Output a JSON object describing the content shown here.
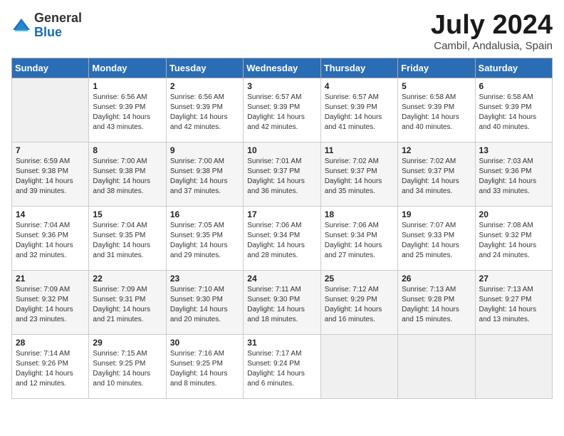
{
  "header": {
    "logo_general": "General",
    "logo_blue": "Blue",
    "month_title": "July 2024",
    "location": "Cambil, Andalusia, Spain"
  },
  "days_of_week": [
    "Sunday",
    "Monday",
    "Tuesday",
    "Wednesday",
    "Thursday",
    "Friday",
    "Saturday"
  ],
  "weeks": [
    [
      {
        "day": "",
        "sunrise": "",
        "sunset": "",
        "daylight": ""
      },
      {
        "day": "1",
        "sunrise": "Sunrise: 6:56 AM",
        "sunset": "Sunset: 9:39 PM",
        "daylight": "Daylight: 14 hours and 43 minutes."
      },
      {
        "day": "2",
        "sunrise": "Sunrise: 6:56 AM",
        "sunset": "Sunset: 9:39 PM",
        "daylight": "Daylight: 14 hours and 42 minutes."
      },
      {
        "day": "3",
        "sunrise": "Sunrise: 6:57 AM",
        "sunset": "Sunset: 9:39 PM",
        "daylight": "Daylight: 14 hours and 42 minutes."
      },
      {
        "day": "4",
        "sunrise": "Sunrise: 6:57 AM",
        "sunset": "Sunset: 9:39 PM",
        "daylight": "Daylight: 14 hours and 41 minutes."
      },
      {
        "day": "5",
        "sunrise": "Sunrise: 6:58 AM",
        "sunset": "Sunset: 9:39 PM",
        "daylight": "Daylight: 14 hours and 40 minutes."
      },
      {
        "day": "6",
        "sunrise": "Sunrise: 6:58 AM",
        "sunset": "Sunset: 9:39 PM",
        "daylight": "Daylight: 14 hours and 40 minutes."
      }
    ],
    [
      {
        "day": "7",
        "sunrise": "Sunrise: 6:59 AM",
        "sunset": "Sunset: 9:38 PM",
        "daylight": "Daylight: 14 hours and 39 minutes."
      },
      {
        "day": "8",
        "sunrise": "Sunrise: 7:00 AM",
        "sunset": "Sunset: 9:38 PM",
        "daylight": "Daylight: 14 hours and 38 minutes."
      },
      {
        "day": "9",
        "sunrise": "Sunrise: 7:00 AM",
        "sunset": "Sunset: 9:38 PM",
        "daylight": "Daylight: 14 hours and 37 minutes."
      },
      {
        "day": "10",
        "sunrise": "Sunrise: 7:01 AM",
        "sunset": "Sunset: 9:37 PM",
        "daylight": "Daylight: 14 hours and 36 minutes."
      },
      {
        "day": "11",
        "sunrise": "Sunrise: 7:02 AM",
        "sunset": "Sunset: 9:37 PM",
        "daylight": "Daylight: 14 hours and 35 minutes."
      },
      {
        "day": "12",
        "sunrise": "Sunrise: 7:02 AM",
        "sunset": "Sunset: 9:37 PM",
        "daylight": "Daylight: 14 hours and 34 minutes."
      },
      {
        "day": "13",
        "sunrise": "Sunrise: 7:03 AM",
        "sunset": "Sunset: 9:36 PM",
        "daylight": "Daylight: 14 hours and 33 minutes."
      }
    ],
    [
      {
        "day": "14",
        "sunrise": "Sunrise: 7:04 AM",
        "sunset": "Sunset: 9:36 PM",
        "daylight": "Daylight: 14 hours and 32 minutes."
      },
      {
        "day": "15",
        "sunrise": "Sunrise: 7:04 AM",
        "sunset": "Sunset: 9:35 PM",
        "daylight": "Daylight: 14 hours and 31 minutes."
      },
      {
        "day": "16",
        "sunrise": "Sunrise: 7:05 AM",
        "sunset": "Sunset: 9:35 PM",
        "daylight": "Daylight: 14 hours and 29 minutes."
      },
      {
        "day": "17",
        "sunrise": "Sunrise: 7:06 AM",
        "sunset": "Sunset: 9:34 PM",
        "daylight": "Daylight: 14 hours and 28 minutes."
      },
      {
        "day": "18",
        "sunrise": "Sunrise: 7:06 AM",
        "sunset": "Sunset: 9:34 PM",
        "daylight": "Daylight: 14 hours and 27 minutes."
      },
      {
        "day": "19",
        "sunrise": "Sunrise: 7:07 AM",
        "sunset": "Sunset: 9:33 PM",
        "daylight": "Daylight: 14 hours and 25 minutes."
      },
      {
        "day": "20",
        "sunrise": "Sunrise: 7:08 AM",
        "sunset": "Sunset: 9:32 PM",
        "daylight": "Daylight: 14 hours and 24 minutes."
      }
    ],
    [
      {
        "day": "21",
        "sunrise": "Sunrise: 7:09 AM",
        "sunset": "Sunset: 9:32 PM",
        "daylight": "Daylight: 14 hours and 23 minutes."
      },
      {
        "day": "22",
        "sunrise": "Sunrise: 7:09 AM",
        "sunset": "Sunset: 9:31 PM",
        "daylight": "Daylight: 14 hours and 21 minutes."
      },
      {
        "day": "23",
        "sunrise": "Sunrise: 7:10 AM",
        "sunset": "Sunset: 9:30 PM",
        "daylight": "Daylight: 14 hours and 20 minutes."
      },
      {
        "day": "24",
        "sunrise": "Sunrise: 7:11 AM",
        "sunset": "Sunset: 9:30 PM",
        "daylight": "Daylight: 14 hours and 18 minutes."
      },
      {
        "day": "25",
        "sunrise": "Sunrise: 7:12 AM",
        "sunset": "Sunset: 9:29 PM",
        "daylight": "Daylight: 14 hours and 16 minutes."
      },
      {
        "day": "26",
        "sunrise": "Sunrise: 7:13 AM",
        "sunset": "Sunset: 9:28 PM",
        "daylight": "Daylight: 14 hours and 15 minutes."
      },
      {
        "day": "27",
        "sunrise": "Sunrise: 7:13 AM",
        "sunset": "Sunset: 9:27 PM",
        "daylight": "Daylight: 14 hours and 13 minutes."
      }
    ],
    [
      {
        "day": "28",
        "sunrise": "Sunrise: 7:14 AM",
        "sunset": "Sunset: 9:26 PM",
        "daylight": "Daylight: 14 hours and 12 minutes."
      },
      {
        "day": "29",
        "sunrise": "Sunrise: 7:15 AM",
        "sunset": "Sunset: 9:25 PM",
        "daylight": "Daylight: 14 hours and 10 minutes."
      },
      {
        "day": "30",
        "sunrise": "Sunrise: 7:16 AM",
        "sunset": "Sunset: 9:25 PM",
        "daylight": "Daylight: 14 hours and 8 minutes."
      },
      {
        "day": "31",
        "sunrise": "Sunrise: 7:17 AM",
        "sunset": "Sunset: 9:24 PM",
        "daylight": "Daylight: 14 hours and 6 minutes."
      },
      {
        "day": "",
        "sunrise": "",
        "sunset": "",
        "daylight": ""
      },
      {
        "day": "",
        "sunrise": "",
        "sunset": "",
        "daylight": ""
      },
      {
        "day": "",
        "sunrise": "",
        "sunset": "",
        "daylight": ""
      }
    ]
  ]
}
